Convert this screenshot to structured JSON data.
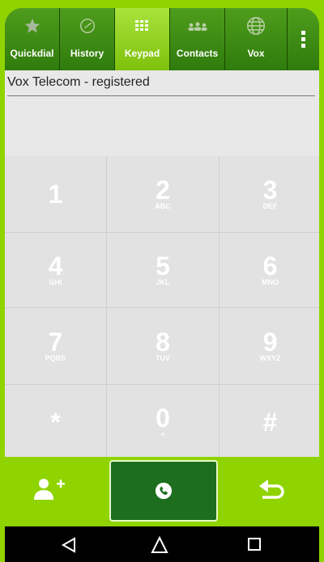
{
  "tabs": [
    {
      "label": "Quickdial",
      "icon": "star-icon",
      "active": false
    },
    {
      "label": "History",
      "icon": "history-icon",
      "active": false
    },
    {
      "label": "Keypad",
      "icon": "keypad-icon",
      "active": true
    },
    {
      "label": "Contacts",
      "icon": "contacts-icon",
      "active": false
    },
    {
      "label": "Vox",
      "icon": "globe-icon",
      "active": false
    }
  ],
  "status": {
    "text": "Vox Telecom - registered"
  },
  "keys": [
    {
      "digit": "1",
      "letters": ""
    },
    {
      "digit": "2",
      "letters": "ABC"
    },
    {
      "digit": "3",
      "letters": "DEF"
    },
    {
      "digit": "4",
      "letters": "GHI"
    },
    {
      "digit": "5",
      "letters": "JKL"
    },
    {
      "digit": "6",
      "letters": "MNO"
    },
    {
      "digit": "7",
      "letters": "PQRS"
    },
    {
      "digit": "8",
      "letters": "TUV"
    },
    {
      "digit": "9",
      "letters": "WXYZ"
    },
    {
      "digit": "*",
      "letters": ""
    },
    {
      "digit": "0",
      "letters": "+"
    },
    {
      "digit": "#",
      "letters": ""
    }
  ],
  "colors": {
    "brand_green": "#8fd400",
    "tab_dark": "#2f7b0d",
    "active_tab": "#9bdb2a",
    "call_button": "#1d6e1e",
    "key_bg": "#e2e2e2"
  }
}
